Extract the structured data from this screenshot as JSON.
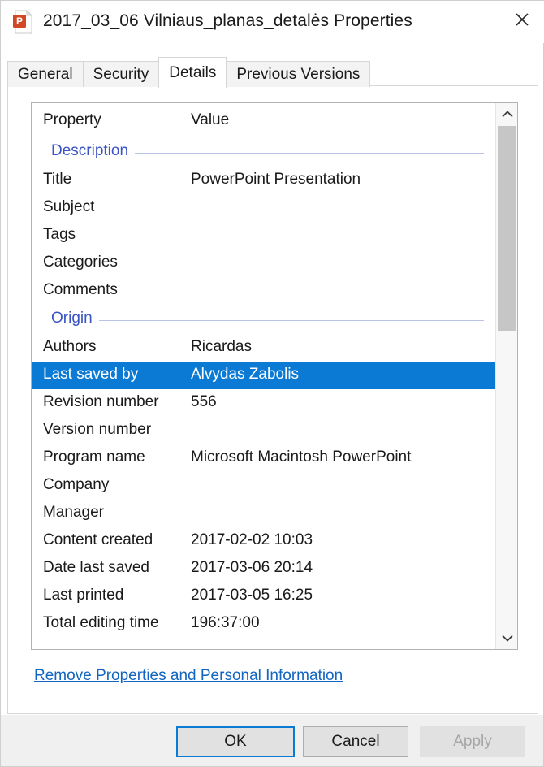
{
  "window": {
    "title": "2017_03_06 Vilniaus_planas_detalės Properties",
    "icon": "powerpoint-file-icon",
    "close_label": "✕"
  },
  "tabs": [
    {
      "label": "General",
      "selected": false
    },
    {
      "label": "Security",
      "selected": false
    },
    {
      "label": "Details",
      "selected": true
    },
    {
      "label": "Previous Versions",
      "selected": false
    }
  ],
  "list": {
    "headers": {
      "property": "Property",
      "value": "Value"
    },
    "sections": [
      {
        "name": "Description",
        "rows": [
          {
            "property": "Title",
            "value": "PowerPoint Presentation",
            "selected": false
          },
          {
            "property": "Subject",
            "value": "",
            "selected": false
          },
          {
            "property": "Tags",
            "value": "",
            "selected": false
          },
          {
            "property": "Categories",
            "value": "",
            "selected": false
          },
          {
            "property": "Comments",
            "value": "",
            "selected": false
          }
        ]
      },
      {
        "name": "Origin",
        "rows": [
          {
            "property": "Authors",
            "value": "Ricardas",
            "selected": false
          },
          {
            "property": "Last saved by",
            "value": "Alvydas Zabolis",
            "selected": true
          },
          {
            "property": "Revision number",
            "value": "556",
            "selected": false
          },
          {
            "property": "Version number",
            "value": "",
            "selected": false
          },
          {
            "property": "Program name",
            "value": "Microsoft Macintosh PowerPoint",
            "selected": false
          },
          {
            "property": "Company",
            "value": "",
            "selected": false
          },
          {
            "property": "Manager",
            "value": "",
            "selected": false
          },
          {
            "property": "Content created",
            "value": "2017-02-02 10:03",
            "selected": false
          },
          {
            "property": "Date last saved",
            "value": "2017-03-06 20:14",
            "selected": false
          },
          {
            "property": "Last printed",
            "value": "2017-03-05 16:25",
            "selected": false
          },
          {
            "property": "Total editing time",
            "value": "196:37:00",
            "selected": false
          }
        ]
      }
    ]
  },
  "scrollbar": {
    "up_icon": "chevron-up-icon",
    "down_icon": "chevron-down-icon"
  },
  "remove_link": "Remove Properties and Personal Information",
  "buttons": {
    "ok": "OK",
    "cancel": "Cancel",
    "apply": "Apply"
  },
  "colors": {
    "selection_blue": "#0a7ad4",
    "section_header_blue": "#3b54c4",
    "link_blue": "#1265c0",
    "focus_border": "#0a7ad4"
  }
}
